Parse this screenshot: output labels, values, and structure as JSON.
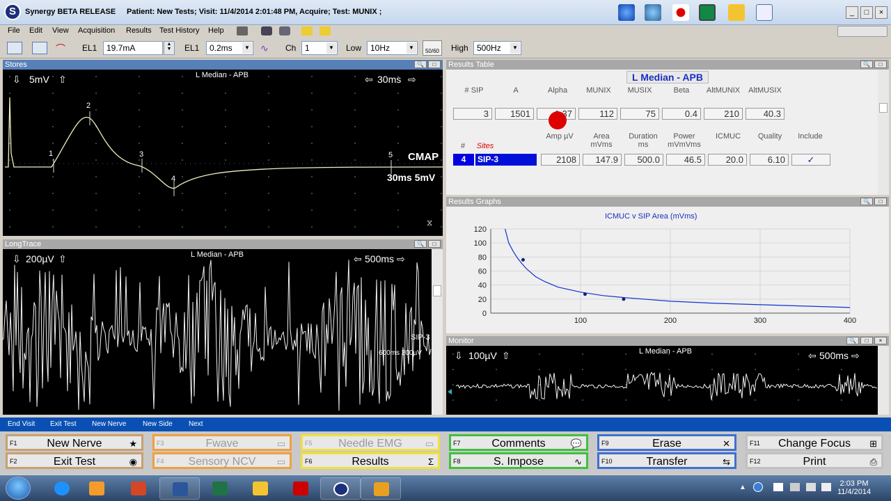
{
  "window": {
    "title": "Synergy BETA RELEASE",
    "info": "Patient: New Tests;   Visit: 11/4/2014 2:01:48 PM, Acquire; Test: MUNIX ;",
    "controls": [
      "_",
      "□",
      "×"
    ]
  },
  "menu": [
    "File",
    "Edit",
    "View",
    "Acquisition",
    "Results",
    "Test History",
    "Help"
  ],
  "toolbar": {
    "el1_label": "EL1",
    "el1_value": "19.7mA",
    "el1b_label": "EL1",
    "el1b_value": "0.2ms",
    "ch_label": "Ch",
    "ch_value": "1",
    "low_label": "Low",
    "low_value": "10Hz",
    "notch_label": "50/60",
    "high_label": "High",
    "high_value": "500Hz"
  },
  "stores": {
    "header": "Stores",
    "title": "L Median - APB",
    "gain": "5mV",
    "sweep": "30ms",
    "cmap_label": "CMAP",
    "cmap_scale": "30ms 5mV",
    "markers": [
      "1",
      "2",
      "3",
      "4",
      "5"
    ]
  },
  "longtrace": {
    "header": "LongTrace",
    "title": "L Median - APB",
    "gain": "200µV",
    "sweep": "500ms",
    "sip_label": "SIP-3",
    "scale": "600ms 200µV"
  },
  "results_table": {
    "header": "Results Table",
    "muscle": "L Median - APB",
    "columns": [
      "# SIP",
      "A",
      "Alpha",
      "MUNIX",
      "MUSIX",
      "Beta",
      "AltMUNIX",
      "AltMUSIX"
    ],
    "values": [
      "3",
      "1501",
      "1.37",
      "112",
      "75",
      "0.4",
      "210",
      "40.3"
    ],
    "site_columns": [
      "#",
      "Sites",
      "Amp µV",
      "Area mVms",
      "Duration ms",
      "Power mVmVms",
      "ICMUC",
      "Quality",
      "Include"
    ],
    "site_row": {
      "num": "4",
      "site": "SIP-3",
      "amp": "2108",
      "area": "147.9",
      "duration": "500.0",
      "power": "46.5",
      "icmuc": "20.0",
      "quality": "6.10",
      "include": "✓"
    }
  },
  "results_graphs": {
    "header": "Results Graphs"
  },
  "chart_data": {
    "type": "line",
    "title": "ICMUC v SIP Area (mVms)",
    "xlim": [
      0,
      400
    ],
    "ylim": [
      0,
      120
    ],
    "xticks": [
      "100",
      "200",
      "300",
      "400"
    ],
    "yticks": [
      "0",
      "20",
      "40",
      "60",
      "80",
      "100",
      "120"
    ],
    "curve_x": [
      16,
      20,
      25,
      30,
      35,
      40,
      50,
      60,
      75,
      100,
      125,
      150,
      200,
      250,
      300,
      350,
      400
    ],
    "curve_y": [
      120,
      100,
      88,
      78,
      70,
      63,
      52,
      45,
      37,
      30,
      25,
      22,
      17,
      14,
      12,
      10,
      8
    ],
    "points_x": [
      36,
      105,
      148
    ],
    "points_y": [
      76,
      27,
      20
    ],
    "line_color": "#1030d0"
  },
  "monitor": {
    "header": "Monitor",
    "title": "L Median - APB",
    "gain": "100µV",
    "sweep": "500ms"
  },
  "footer_links": [
    "End Visit",
    "Exit Test",
    "New Nerve",
    "New Side",
    "Next"
  ],
  "fkeys": [
    {
      "key": "F1",
      "label": "New Nerve",
      "icon": "★",
      "color": "#c8a070",
      "enabled": true
    },
    {
      "key": "F2",
      "label": "Exit Test",
      "icon": "◉",
      "color": "#c8a070",
      "enabled": true
    },
    {
      "key": "F3",
      "label": "Fwave",
      "icon": "▭",
      "color": "#f0a040",
      "enabled": false
    },
    {
      "key": "F4",
      "label": "Sensory NCV",
      "icon": "▭",
      "color": "#f0a040",
      "enabled": false
    },
    {
      "key": "F5",
      "label": "Needle EMG",
      "icon": "▭",
      "color": "#f0e040",
      "enabled": false
    },
    {
      "key": "F6",
      "label": "Results",
      "icon": "Σ",
      "color": "#f0e040",
      "enabled": true
    },
    {
      "key": "F7",
      "label": "Comments",
      "icon": "💬",
      "color": "#40c040",
      "enabled": true
    },
    {
      "key": "F8",
      "label": "S. Impose",
      "icon": "∿",
      "color": "#40c040",
      "enabled": true
    },
    {
      "key": "F9",
      "label": "Erase",
      "icon": "✕",
      "color": "#4070d0",
      "enabled": true
    },
    {
      "key": "F10",
      "label": "Transfer",
      "icon": "⇆",
      "color": "#4070d0",
      "enabled": true
    },
    {
      "key": "F11",
      "label": "Change Focus",
      "icon": "⊞",
      "color": "#c0c0c0",
      "enabled": true
    },
    {
      "key": "F12",
      "label": "Print",
      "icon": "⎙",
      "color": "#c0c0c0",
      "enabled": true
    }
  ],
  "taskbar": {
    "time": "2:03 PM",
    "date": "11/4/2014"
  }
}
